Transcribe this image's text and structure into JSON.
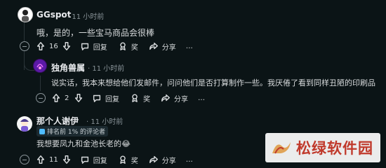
{
  "comments": [
    {
      "username": "GGspot",
      "time": "11 小时前",
      "body": "哦，是的，一些宝马商品会很棒",
      "votes": "16",
      "reply_label": "回复",
      "award_label": "奖",
      "share_label": "分享",
      "more_label": "…"
    },
    {
      "username": "独角兽属",
      "time": "11 小时前",
      "body": "说实话，我本来想给他们发邮件，问问他们是否打算制作一些。我厌倦了看到同样丑陋的印刷品",
      "votes": "2",
      "reply_label": "回复",
      "award_label": "奖",
      "share_label": "分享",
      "more_label": "…"
    },
    {
      "username": "那个人谢伊",
      "time": "11 小时前",
      "badge": "排名前 1% 的评论者",
      "body": "我想要凤九和金池长老的😂",
      "votes": "11",
      "reply_label": "回复",
      "award_label": "奖",
      "share_label": "分享",
      "more_label": "…"
    }
  ],
  "watermark": {
    "text": "松绿软件园"
  },
  "colors": {
    "background": "#0b1416",
    "text": "#d7dadc",
    "meta": "#8a9499",
    "watermark": "#c0392b"
  }
}
